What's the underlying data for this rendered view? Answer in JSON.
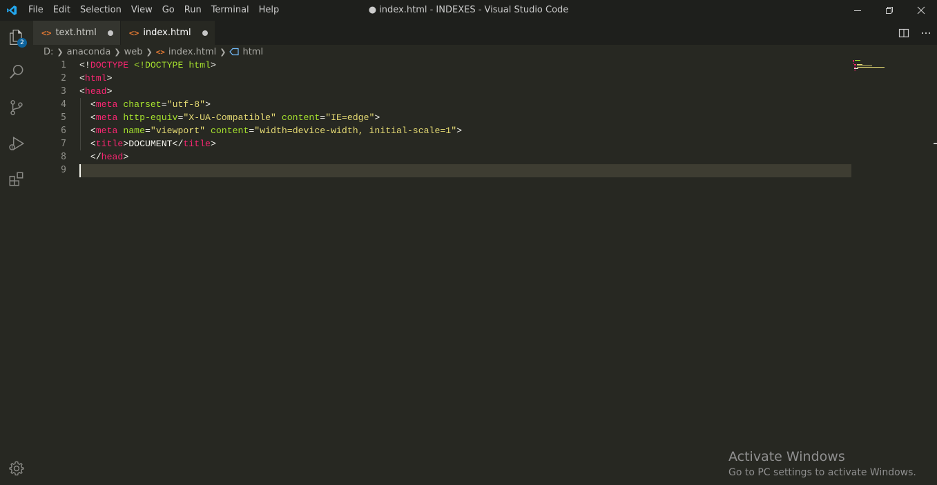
{
  "menu": {
    "items": [
      "File",
      "Edit",
      "Selection",
      "View",
      "Go",
      "Run",
      "Terminal",
      "Help"
    ]
  },
  "window": {
    "title": "● index.html - INDEXES - Visual Studio Code"
  },
  "activity_bar": {
    "explorer_badge": "2",
    "icons": [
      "explorer-icon",
      "search-icon",
      "source-control-icon",
      "run-debug-icon",
      "extensions-icon",
      "gear-icon"
    ]
  },
  "tabs": [
    {
      "label": "text.html",
      "icon": "<>"
    },
    {
      "label": "index.html",
      "icon": "<>"
    }
  ],
  "breadcrumb": {
    "items": [
      "D:",
      "anaconda",
      "web",
      "index.html",
      "html"
    ],
    "file_icon": "<>"
  },
  "editor": {
    "line_numbers": [
      "1",
      "2",
      "3",
      "4",
      "5",
      "6",
      "7",
      "8",
      "9"
    ],
    "lines": [
      [
        {
          "t": "<!",
          "c": "txt"
        },
        {
          "t": "DOCTYPE",
          "c": "tag"
        },
        {
          "t": " ",
          "c": "txt"
        },
        {
          "t": "<!DOCTYPE",
          "c": "attr"
        },
        {
          "t": " ",
          "c": "txt"
        },
        {
          "t": "html",
          "c": "attr"
        },
        {
          "t": ">",
          "c": "txt"
        }
      ],
      [
        {
          "t": "<",
          "c": "txt"
        },
        {
          "t": "html",
          "c": "tag"
        },
        {
          "t": ">",
          "c": "txt"
        }
      ],
      [
        {
          "t": "<",
          "c": "txt"
        },
        {
          "t": "head",
          "c": "tag"
        },
        {
          "t": ">",
          "c": "txt"
        }
      ],
      [
        {
          "t": "  <",
          "c": "txt"
        },
        {
          "t": "meta",
          "c": "tag"
        },
        {
          "t": " ",
          "c": "txt"
        },
        {
          "t": "charset",
          "c": "attr"
        },
        {
          "t": "=",
          "c": "txt"
        },
        {
          "t": "\"utf-8\"",
          "c": "str"
        },
        {
          "t": ">",
          "c": "txt"
        }
      ],
      [
        {
          "t": "  <",
          "c": "txt"
        },
        {
          "t": "meta",
          "c": "tag"
        },
        {
          "t": " ",
          "c": "txt"
        },
        {
          "t": "http-equiv",
          "c": "attr"
        },
        {
          "t": "=",
          "c": "txt"
        },
        {
          "t": "\"X-UA-Compatible\"",
          "c": "str"
        },
        {
          "t": " ",
          "c": "txt"
        },
        {
          "t": "content",
          "c": "attr"
        },
        {
          "t": "=",
          "c": "txt"
        },
        {
          "t": "\"IE=edge\"",
          "c": "str"
        },
        {
          "t": ">",
          "c": "txt"
        }
      ],
      [
        {
          "t": "  <",
          "c": "txt"
        },
        {
          "t": "meta",
          "c": "tag"
        },
        {
          "t": " ",
          "c": "txt"
        },
        {
          "t": "name",
          "c": "attr"
        },
        {
          "t": "=",
          "c": "txt"
        },
        {
          "t": "\"viewport\"",
          "c": "str"
        },
        {
          "t": " ",
          "c": "txt"
        },
        {
          "t": "content",
          "c": "attr"
        },
        {
          "t": "=",
          "c": "txt"
        },
        {
          "t": "\"width=device-width, initial-scale=1\"",
          "c": "str"
        },
        {
          "t": ">",
          "c": "txt"
        }
      ],
      [
        {
          "t": "  <",
          "c": "txt"
        },
        {
          "t": "title",
          "c": "tag"
        },
        {
          "t": ">DOCUMENT</",
          "c": "txt"
        },
        {
          "t": "title",
          "c": "tag"
        },
        {
          "t": ">",
          "c": "txt"
        }
      ],
      [
        {
          "t": "  </",
          "c": "txt"
        },
        {
          "t": "head",
          "c": "tag"
        },
        {
          "t": ">",
          "c": "txt"
        }
      ],
      []
    ]
  },
  "watermark": {
    "title": "Activate Windows",
    "subtitle": "Go to PC settings to activate Windows."
  },
  "colors": {
    "accent": "#007acc",
    "tag": "#f92672",
    "attribute": "#a6e22e",
    "string": "#e6db74",
    "background": "#272822"
  }
}
